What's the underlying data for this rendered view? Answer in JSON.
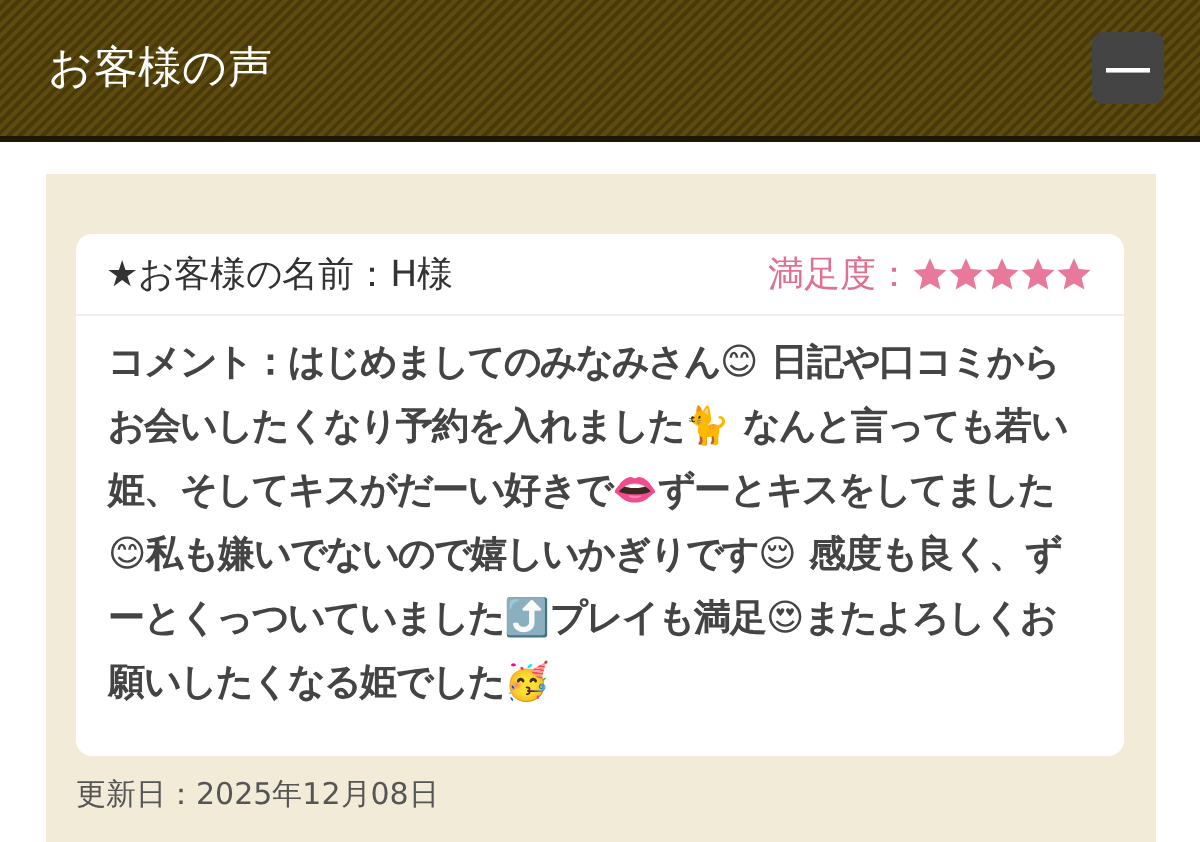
{
  "header": {
    "title": "お客様の声",
    "menu_button": "—"
  },
  "review": {
    "name": "★お客様の名前：H様",
    "rating_label": "満足度：",
    "stars": 5,
    "comment": "コメント：はじめましてのみなみさん😊 日記や口コミからお会いしたくなり予約を入れました🐈 なんと言っても若い姫、そしてキスがだーい好きで👄ずーとキスをしてました😊私も嫌いでないので嬉しいかぎりです😌 感度も良く、ずーとくっついていました⤴️プレイも満足😍またよろしくお願いしたくなる姫でした🥳",
    "updated": "更新日：2025年12月08日"
  }
}
